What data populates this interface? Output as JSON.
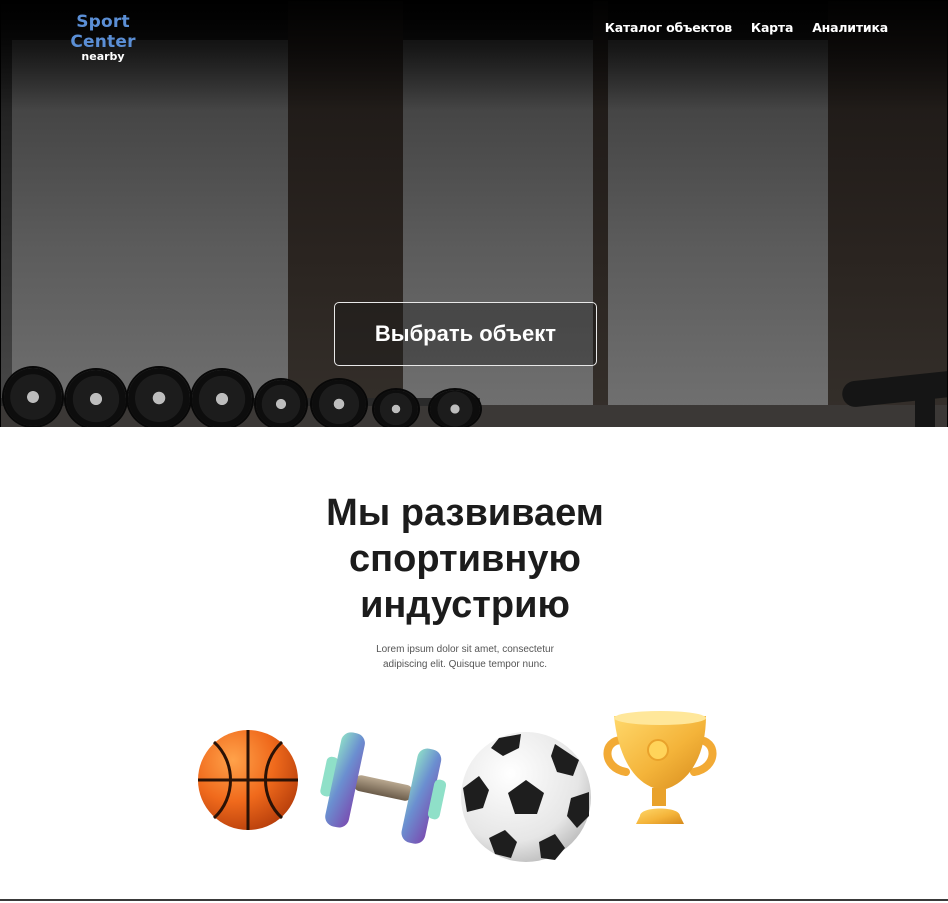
{
  "brand": {
    "name": "Sport Center",
    "tagline": "nearby",
    "color": "#5b8fd6"
  },
  "nav": {
    "items": [
      {
        "label": "Каталог объектов"
      },
      {
        "label": "Карта"
      },
      {
        "label": "Аналитика"
      }
    ]
  },
  "hero": {
    "cta_label": "Выбрать объект"
  },
  "main": {
    "headline_lines": [
      "Мы развиваем",
      "спортивную",
      "индустрию"
    ],
    "subtext_lines": [
      "Lorem ipsum dolor sit amet, consectetur",
      "adipiscing elit. Quisque tempor nunc."
    ]
  },
  "icons": [
    "basketball-icon",
    "dumbbell-icon",
    "soccer-ball-icon",
    "trophy-icon"
  ]
}
